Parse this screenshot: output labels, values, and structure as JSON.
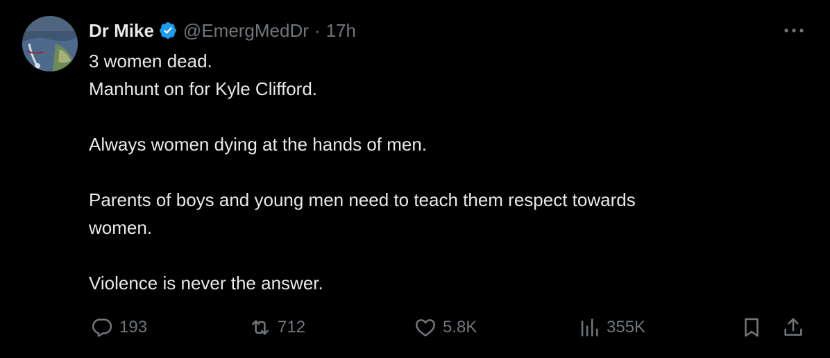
{
  "tweet": {
    "author": {
      "display_name": "Dr Mike",
      "handle": "@EmergMedDr",
      "separator": "·",
      "time": "17h",
      "verified": true
    },
    "lines": [
      "3 women dead.",
      "Manhunt on for Kyle Clifford.",
      "",
      "Always women dying at the hands of men.",
      "",
      "Parents of boys and young men need to teach them respect towards",
      "women.",
      "",
      "Violence is never the answer."
    ],
    "stats": {
      "replies": "193",
      "retweets": "712",
      "likes": "5.8K",
      "views": "355K"
    }
  },
  "icons": {
    "verified": "verified-badge-icon",
    "more": "more-options-icon",
    "reply": "reply-icon",
    "retweet": "retweet-icon",
    "like": "heart-icon",
    "views": "views-chart-icon",
    "bookmark": "bookmark-icon",
    "share": "share-icon"
  },
  "colors": {
    "background": "#000000",
    "text_primary": "#e7e9ea",
    "text_secondary": "#71767b",
    "verified_blue": "#1d9bf0"
  }
}
